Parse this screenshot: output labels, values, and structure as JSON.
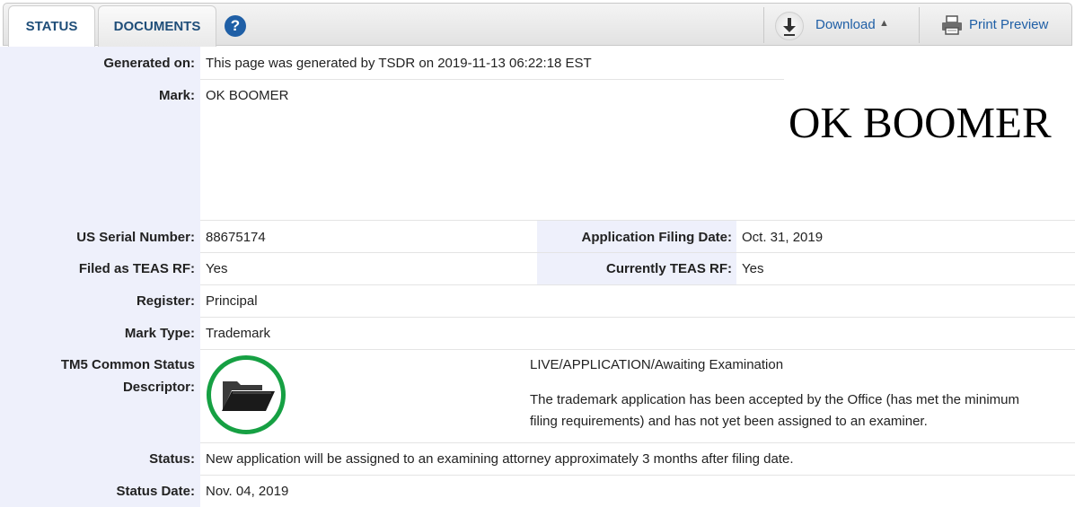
{
  "tabs": {
    "status": "STATUS",
    "documents": "DOCUMENTS",
    "help": "?"
  },
  "toolbar": {
    "download": "Download",
    "download_caret": "▲",
    "print_preview": "Print Preview"
  },
  "record": {
    "generated_on_label": "Generated on:",
    "generated_on": "This page was generated by TSDR on 2019-11-13 06:22:18 EST",
    "mark_label": "Mark:",
    "mark": "OK BOOMER",
    "mark_image_text": "OK BOOMER",
    "serial_label": "US Serial Number:",
    "serial": "88675174",
    "filing_date_label": "Application Filing Date:",
    "filing_date": "Oct. 31, 2019",
    "filed_teas_label": "Filed as TEAS RF:",
    "filed_teas": "Yes",
    "current_teas_label": "Currently TEAS RF:",
    "current_teas": "Yes",
    "register_label": "Register:",
    "register": "Principal",
    "mark_type_label": "Mark Type:",
    "mark_type": "Trademark",
    "tm5_label_line1": "TM5 Common Status",
    "tm5_label_line2": "Descriptor:",
    "tm5_status": "LIVE/APPLICATION/Awaiting Examination",
    "tm5_desc_line1": "The trademark application has been accepted by the Office (has met the minimum",
    "tm5_desc_line2": "filing requirements) and has not yet been assigned to an examiner.",
    "status_label": "Status:",
    "status": "New application will be assigned to an examining attorney approximately 3 months after filing date.",
    "status_date_label": "Status Date:",
    "status_date": "Nov. 04, 2019"
  },
  "colors": {
    "link": "#1f5fa6",
    "label_bg": "#eef0fb",
    "status_ring": "#16a043"
  }
}
